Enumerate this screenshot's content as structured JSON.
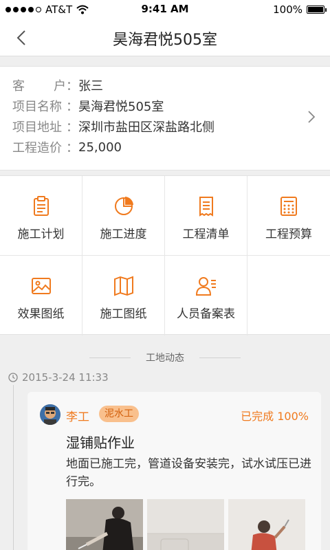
{
  "status_bar": {
    "carrier": "AT&T",
    "time": "9:41 AM",
    "battery": "100%"
  },
  "nav": {
    "title": "昊海君悦505室"
  },
  "info": {
    "rows": [
      {
        "label_a": "客",
        "label_b": "户",
        "value": "张三"
      },
      {
        "label": "项目名称",
        "value": "昊海君悦505室"
      },
      {
        "label": "项目地址",
        "value": "深圳市盐田区深盐路北侧"
      },
      {
        "label": "工程造价",
        "value": "25,000"
      }
    ],
    "colon": "："
  },
  "grid": {
    "items": [
      {
        "label": "施工计划",
        "icon": "clipboard-icon"
      },
      {
        "label": "施工进度",
        "icon": "pie-chart-icon"
      },
      {
        "label": "工程清单",
        "icon": "receipt-icon"
      },
      {
        "label": "工程预算",
        "icon": "calculator-icon"
      },
      {
        "label": "效果图纸",
        "icon": "image-icon"
      },
      {
        "label": "施工图纸",
        "icon": "map-icon"
      },
      {
        "label": "人员备案表",
        "icon": "person-list-icon"
      }
    ]
  },
  "feed": {
    "section_title": "工地动态",
    "timestamp": "2015-3-24 11:33",
    "author": "李工",
    "role": "泥水工",
    "status": "已完成 100%",
    "title": "湿铺贴作业",
    "body": "地面已施工完，管道设备安装完，试水试压已进行完。"
  },
  "colors": {
    "accent": "#f07a1e",
    "badge_bg": "#f9c08d"
  }
}
